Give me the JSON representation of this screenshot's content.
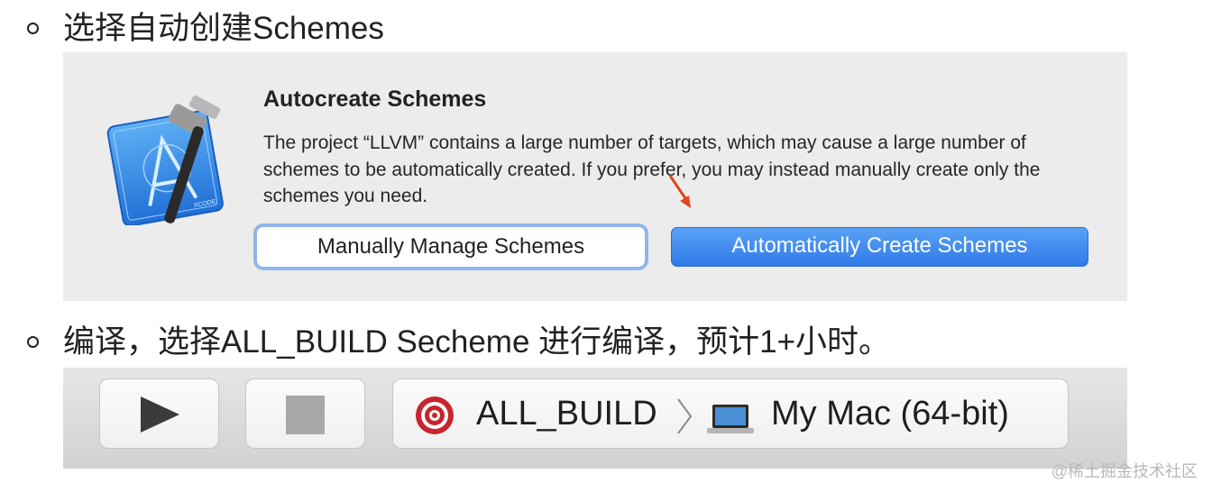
{
  "sections": [
    {
      "heading": "选择自动创建Schemes"
    },
    {
      "heading": "编译，选择ALL_BUILD Secheme 进行编译，预计1+小时。"
    }
  ],
  "dialog": {
    "title": "Autocreate Schemes",
    "message": "The project “LLVM” contains a large number of targets, which may cause a large number of schemes to be automatically created. If you prefer, you may instead manually create only the schemes you need.",
    "manual_button": "Manually Manage Schemes",
    "auto_button": "Automatically Create Schemes",
    "app_icon": "xcode-icon",
    "annotation_icon": "red-arrow-icon",
    "accent_color": "#2f7ae6"
  },
  "toolbar": {
    "run_icon": "play-icon",
    "stop_icon": "stop-icon",
    "scheme_icon": "target-icon",
    "scheme": "ALL_BUILD",
    "separator_icon": "chevron-right-icon",
    "destination_icon": "macbook-icon",
    "destination": "My Mac (64-bit)"
  },
  "watermark": "@稀土掘金技术社区"
}
